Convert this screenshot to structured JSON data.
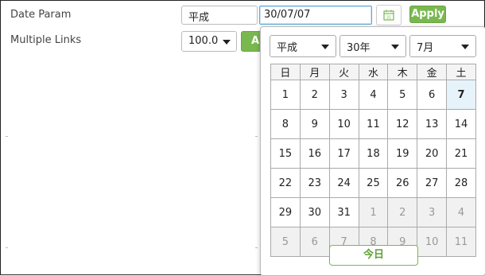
{
  "form": {
    "date_param_label": "Date Param",
    "multiple_links_label": "Multiple Links",
    "era_value": "平成",
    "date_value": "30/07/07",
    "apply_label": "Apply",
    "links_value": "100.0",
    "apply2_label": "Ap"
  },
  "calendar": {
    "era": "平成",
    "year": "30年",
    "month": "7月",
    "weekdays": [
      "日",
      "月",
      "火",
      "水",
      "木",
      "金",
      "土"
    ],
    "weeks": [
      [
        {
          "d": "1"
        },
        {
          "d": "2"
        },
        {
          "d": "3"
        },
        {
          "d": "4"
        },
        {
          "d": "5"
        },
        {
          "d": "6"
        },
        {
          "d": "7",
          "selected": true
        }
      ],
      [
        {
          "d": "8"
        },
        {
          "d": "9"
        },
        {
          "d": "10"
        },
        {
          "d": "11"
        },
        {
          "d": "12"
        },
        {
          "d": "13"
        },
        {
          "d": "14"
        }
      ],
      [
        {
          "d": "15"
        },
        {
          "d": "16"
        },
        {
          "d": "17"
        },
        {
          "d": "18"
        },
        {
          "d": "19"
        },
        {
          "d": "20"
        },
        {
          "d": "21"
        }
      ],
      [
        {
          "d": "22"
        },
        {
          "d": "23"
        },
        {
          "d": "24"
        },
        {
          "d": "25"
        },
        {
          "d": "26"
        },
        {
          "d": "27"
        },
        {
          "d": "28"
        }
      ],
      [
        {
          "d": "29"
        },
        {
          "d": "30"
        },
        {
          "d": "31"
        },
        {
          "d": "1",
          "other": true
        },
        {
          "d": "2",
          "other": true
        },
        {
          "d": "3",
          "other": true
        },
        {
          "d": "4",
          "other": true
        }
      ],
      [
        {
          "d": "5",
          "other": true
        },
        {
          "d": "6",
          "other": true
        },
        {
          "d": "7",
          "other": true
        },
        {
          "d": "8",
          "other": true
        },
        {
          "d": "9",
          "other": true
        },
        {
          "d": "10",
          "other": true
        },
        {
          "d": "11",
          "other": true
        }
      ]
    ],
    "today_label": "今日"
  },
  "colors": {
    "accent_green": "#79b84f",
    "focus_blue": "#5aa9d6",
    "selected_bg": "#e6f3fb"
  },
  "icons": {
    "calendar": "calendar-icon",
    "dropdown": "chevron-down-icon"
  }
}
